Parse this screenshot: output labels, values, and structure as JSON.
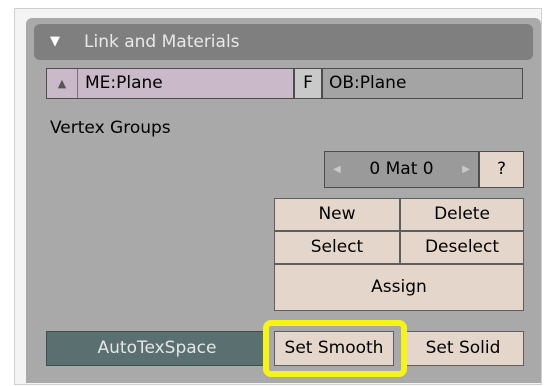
{
  "header": {
    "title": "Link and Materials",
    "toggle_icon": "triangle-down-icon"
  },
  "mesh": {
    "name": "ME:Plane",
    "arrow_icon": "up-down-arrows-icon",
    "fake_user_label": "F"
  },
  "object": {
    "name": "OB:Plane"
  },
  "vertex_groups": {
    "label": "Vertex Groups"
  },
  "material": {
    "value": "0 Mat 0",
    "help_label": "?"
  },
  "vertex_group_buttons": {
    "new": "New",
    "delete": "Delete",
    "select": "Select",
    "deselect": "Deselect",
    "assign": "Assign"
  },
  "bottom": {
    "autotexspace": "AutoTexSpace",
    "set_smooth": "Set Smooth",
    "set_solid": "Set Solid"
  },
  "colors": {
    "panel": "#a9a9a9",
    "header": "#7f7f7f",
    "button": "#e5d6cb",
    "mesh_field": "#c9b9c9",
    "toggle_active": "#5a6f70",
    "highlight": "#f6f31a"
  }
}
